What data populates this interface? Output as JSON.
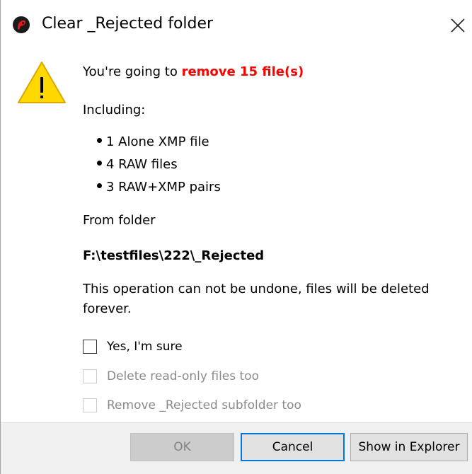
{
  "dialog": {
    "title": "Clear _Rejected folder",
    "close_symbol": "✕",
    "icons": {
      "app": "app-logo-icon",
      "warning": "warning-icon",
      "close": "close-icon"
    },
    "colors": {
      "highlight": "#ff0000",
      "focus_border": "#0078d7",
      "footer_bg": "#f0f0f0",
      "warning_yellow": "#ffd800"
    }
  },
  "message": {
    "prefix": "You're going to ",
    "highlight": "remove 15 file(s)",
    "including_label": "Including:",
    "items": [
      "1 Alone XMP file",
      "4 RAW files",
      "3 RAW+XMP pairs"
    ],
    "from_folder_label": "From folder",
    "folder_path": "F:\\testfiles\\222\\_Rejected",
    "warning": "This operation can not be undone, files will be deleted forever."
  },
  "options": {
    "confirm": {
      "label": "Yes, I'm sure",
      "checked": false,
      "enabled": true
    },
    "readonly": {
      "label": "Delete read-only files too",
      "checked": false,
      "enabled": false
    },
    "subfolder": {
      "label": "Remove _Rejected subfolder too",
      "checked": false,
      "enabled": false
    }
  },
  "buttons": {
    "ok": "OK",
    "cancel": "Cancel",
    "explorer": "Show in Explorer"
  }
}
